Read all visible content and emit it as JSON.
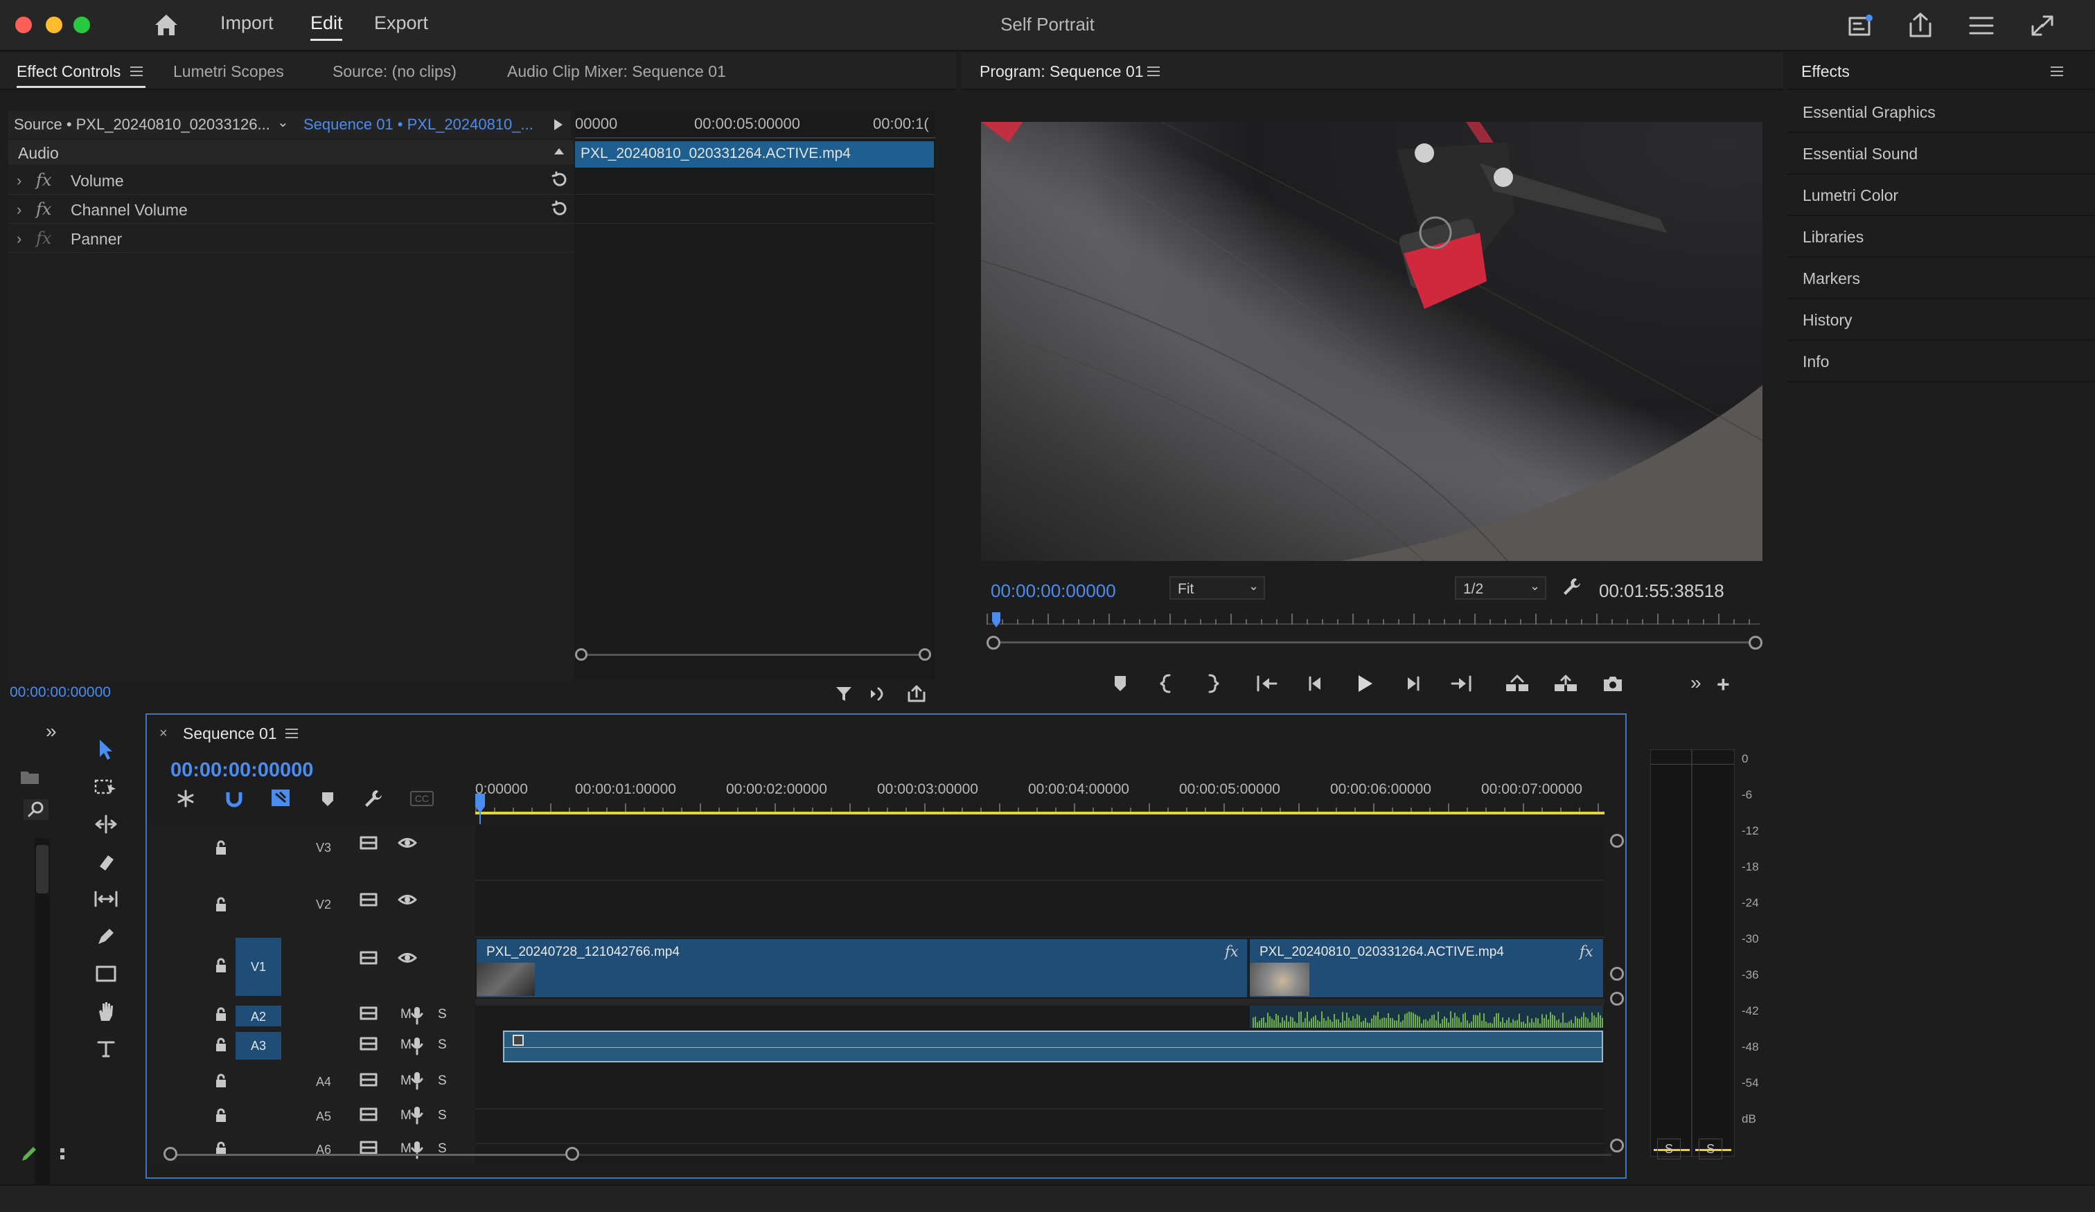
{
  "window": {
    "title": "Self Portrait"
  },
  "menu": {
    "import": "Import",
    "edit": "Edit",
    "export": "Export"
  },
  "header_icons": [
    "quick-export-icon",
    "share-icon",
    "workspaces-icon",
    "fullscreen-icon"
  ],
  "effect_controls": {
    "tabs": [
      "Effect Controls",
      "Lumetri Scopes",
      "Source: (no clips)",
      "Audio Clip Mixer: Sequence 01"
    ],
    "source_label": "Source • PXL_20240810_02033126...",
    "sequence_label": "Sequence 01 • PXL_20240810_...",
    "ruler": [
      "00000",
      "00:00:05:00000",
      "00:00:1("
    ],
    "clip_name": "PXL_20240810_020331264.ACTIVE.mp4",
    "section": "Audio",
    "rows": [
      {
        "fx": "fx",
        "name": "Volume"
      },
      {
        "fx": "fx",
        "name": "Channel Volume"
      },
      {
        "fx": "fx",
        "name": "Panner"
      }
    ],
    "timecode": "00:00:00:00000"
  },
  "program": {
    "title": "Program: Sequence 01",
    "timecode": "00:00:00:00000",
    "fit": "Fit",
    "resolution": "1/2",
    "duration": "00:01:55:38518"
  },
  "effects_panel": {
    "title": "Effects",
    "items": [
      "Essential Graphics",
      "Essential Sound",
      "Lumetri Color",
      "Libraries",
      "Markers",
      "History",
      "Info"
    ]
  },
  "timeline": {
    "tab": "Sequence 01",
    "timecode": "00:00:00:00000",
    "ruler": [
      "0:00000",
      "00:00:01:00000",
      "00:00:02:00000",
      "00:00:03:00000",
      "00:00:04:00000",
      "00:00:05:00000",
      "00:00:06:00000",
      "00:00:07:00000"
    ],
    "video_tracks": [
      "V3",
      "V2",
      "V1"
    ],
    "audio_tracks": [
      "A2",
      "A3",
      "A4",
      "A5",
      "A6"
    ],
    "track_m": "M",
    "track_s": "S",
    "clips": [
      {
        "name": "PXL_20240728_121042766.mp4",
        "fx": "fx"
      },
      {
        "name": "PXL_20240810_020331264.ACTIVE.mp4",
        "fx": "fx"
      }
    ]
  },
  "meter": {
    "labels": [
      "0",
      "-6",
      "-12",
      "-18",
      "-24",
      "-30",
      "-36",
      "-42",
      "-48",
      "-54",
      "dB"
    ],
    "solo": "S"
  },
  "colors": {
    "accent": "#4a8df0",
    "clip": "#1f4d75",
    "audio_clip": "#275a7c",
    "waveform": "#6fae4a",
    "yellow": "#e3d438"
  }
}
